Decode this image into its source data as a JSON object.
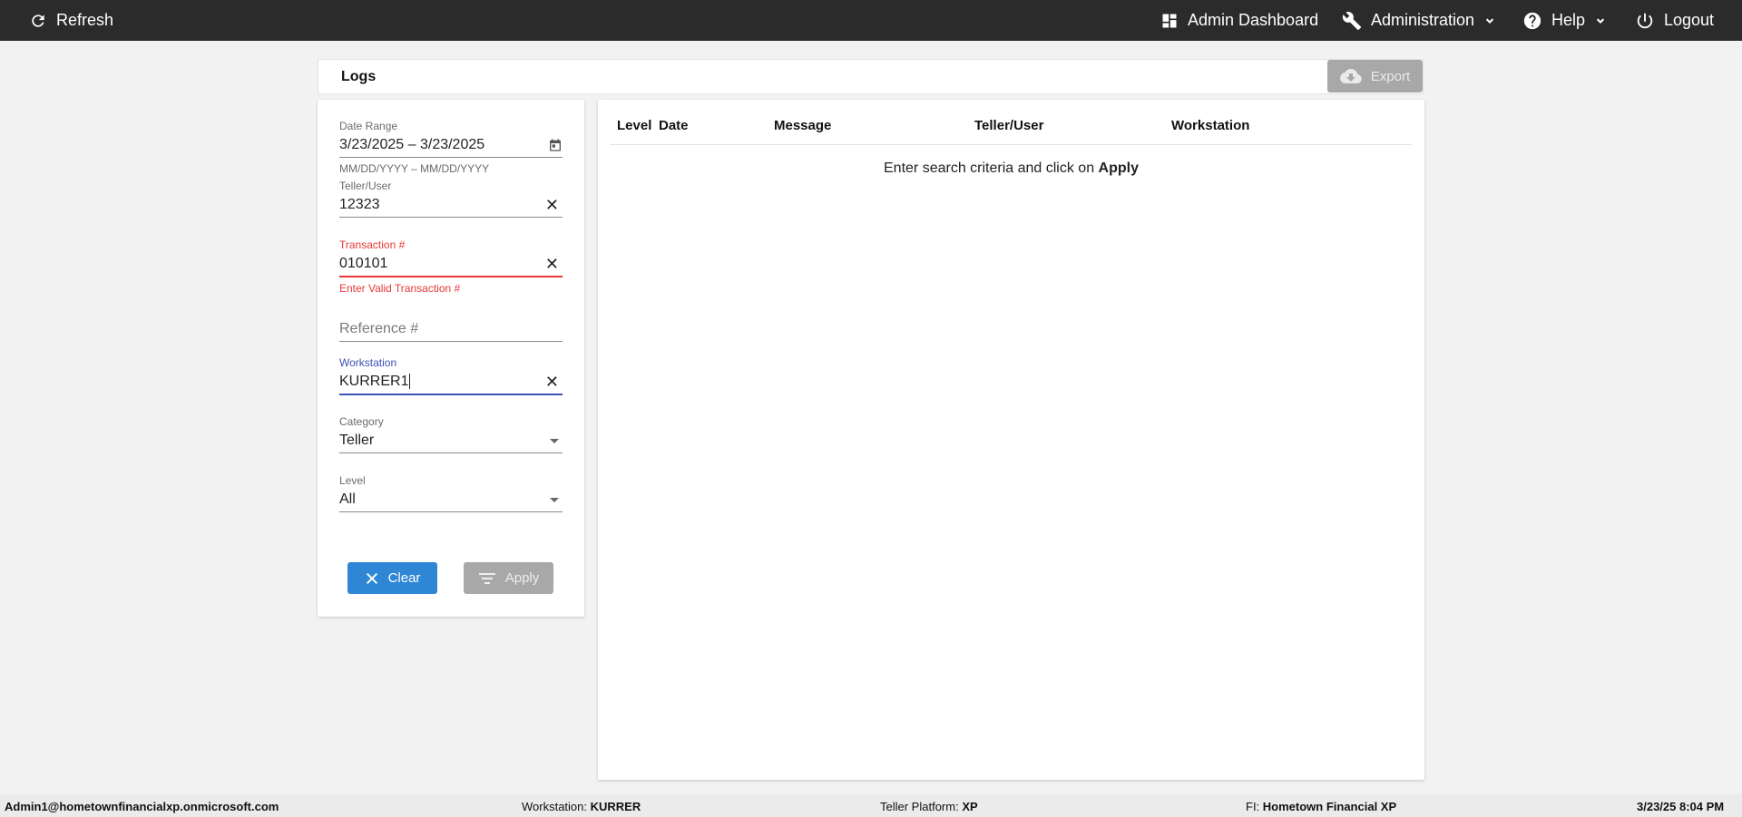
{
  "topbar": {
    "refresh_label": "Refresh",
    "admin_dashboard_label": "Admin Dashboard",
    "administration_label": "Administration",
    "help_label": "Help",
    "logout_label": "Logout"
  },
  "logs": {
    "title": "Logs",
    "export_label": "Export"
  },
  "filters": {
    "date_range": {
      "label": "Date Range",
      "value": "3/23/2025 – 3/23/2025",
      "hint": "MM/DD/YYYY – MM/DD/YYYY"
    },
    "teller_user": {
      "label": "Teller/User",
      "value": "12323"
    },
    "transaction": {
      "label": "Transaction #",
      "value": "010101",
      "error": "Enter Valid Transaction #"
    },
    "reference": {
      "placeholder": "Reference #"
    },
    "workstation": {
      "label": "Workstation",
      "value": "KURRER1"
    },
    "category": {
      "label": "Category",
      "value": "Teller"
    },
    "level": {
      "label": "Level",
      "value": "All"
    },
    "clear_label": "Clear",
    "apply_label": "Apply"
  },
  "results": {
    "columns": [
      "Level",
      "Date",
      "Message",
      "Teller/User",
      "Workstation"
    ],
    "empty_prefix": "Enter search criteria and click on ",
    "empty_action": "Apply"
  },
  "footer": {
    "user": "Admin1@hometownfinancialxp.onmicrosoft.com",
    "workstation_label": "Workstation: ",
    "workstation_value": "KURRER",
    "platform_label": "Teller Platform: ",
    "platform_value": "XP",
    "fi_label": "FI: ",
    "fi_value": "Hometown Financial XP",
    "datetime": "3/23/25 8:04 PM"
  },
  "colors": {
    "topbar_bg": "#2b2b2b",
    "clear_button": "#2e86d4",
    "disabled_button": "#a8a8a8",
    "error": "#e53935",
    "focus": "#3f51b5"
  }
}
